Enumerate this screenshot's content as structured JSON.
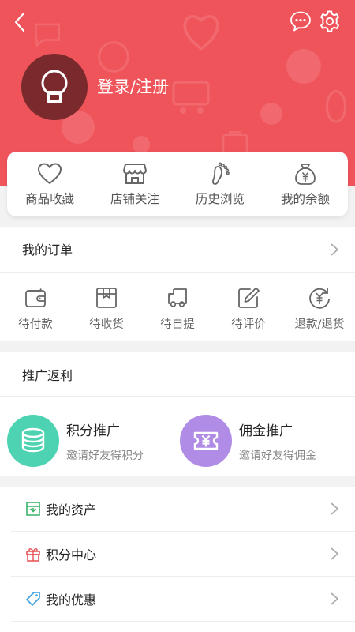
{
  "header": {
    "login_label": "登录/注册"
  },
  "quick_links": [
    {
      "label": "商品收藏",
      "icon": "heart-icon"
    },
    {
      "label": "店铺关注",
      "icon": "store-icon"
    },
    {
      "label": "历史浏览",
      "icon": "footprint-icon"
    },
    {
      "label": "我的余额",
      "icon": "money-bag-icon"
    }
  ],
  "orders": {
    "title": "我的订单",
    "items": [
      {
        "label": "待付款",
        "icon": "wallet-icon"
      },
      {
        "label": "待收货",
        "icon": "box-icon"
      },
      {
        "label": "待自提",
        "icon": "truck-icon"
      },
      {
        "label": "待评价",
        "icon": "edit-icon"
      },
      {
        "label": "退款/退货",
        "icon": "refund-icon"
      }
    ]
  },
  "promotion": {
    "title": "推广返利",
    "items": [
      {
        "title": "积分推广",
        "subtitle": "邀请好友得积分",
        "color": "#4dd3b1"
      },
      {
        "title": "佣金推广",
        "subtitle": "邀请好友得佣金",
        "color": "#b18ce6"
      }
    ]
  },
  "menu": [
    {
      "label": "我的资产",
      "icon": "asset-icon",
      "color": "#38b46a"
    },
    {
      "label": "积分中心",
      "icon": "gift-icon",
      "color": "#e8585c"
    },
    {
      "label": "我的优惠",
      "icon": "coupon-tag-icon",
      "color": "#3a9fe0"
    }
  ],
  "colors": {
    "brand": "#ef545a"
  }
}
